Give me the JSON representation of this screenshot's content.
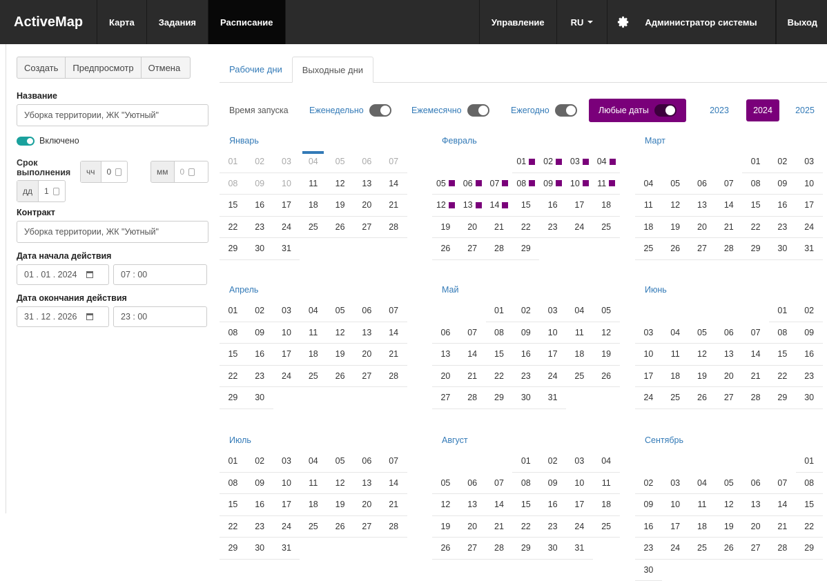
{
  "nav": {
    "brand": "ActiveMap",
    "items": [
      {
        "label": "Карта",
        "name": "nav-item-map"
      },
      {
        "label": "Задания",
        "name": "nav-item-tasks"
      },
      {
        "label": "Расписание",
        "name": "nav-item-schedule"
      }
    ],
    "right": {
      "manage": "Управление",
      "lang": "RU",
      "user": "Администратор системы",
      "logout": "Выход"
    }
  },
  "toolbar": {
    "create": "Создать",
    "preview": "Предпросмотр",
    "cancel": "Отмена"
  },
  "form": {
    "name_label": "Название",
    "name_value": "Уборка территории, ЖК \"Уютный\"",
    "enabled_label": "Включено",
    "deadline_label": "Срок выполнения",
    "hh_label": "чч",
    "hh_value": "0",
    "mm_label": "мм",
    "mm_value": "0",
    "dd_label": "дд",
    "dd_value": "1",
    "contract_label": "Контракт",
    "contract_value": "Уборка территории, ЖК \"Уютный\"",
    "start_label": "Дата начала действия",
    "start_date": "01 . 01 . 2024",
    "start_time": "07 : 00",
    "end_label": "Дата окончания действия",
    "end_date": "31 . 12 . 2026",
    "end_time": "23 : 00"
  },
  "tabs": {
    "workdays": "Рабочие дни",
    "weekends": "Выходные дни"
  },
  "options": {
    "launch_time": "Время запуска",
    "weekly": "Еженедельно",
    "monthly": "Ежемесячно",
    "yearly": "Ежегодно",
    "any_dates": "Любые даты",
    "years": [
      "2023",
      "2024",
      "2025"
    ],
    "selected_year": "2024"
  },
  "months": [
    {
      "name": "Январь",
      "offset": 0,
      "days": 31,
      "past_through": 10,
      "today": 4,
      "marked": []
    },
    {
      "name": "Февраль",
      "offset": 3,
      "days": 29,
      "past_through": 0,
      "today": 0,
      "marked": [
        1,
        2,
        3,
        4,
        5,
        6,
        7,
        8,
        9,
        10,
        11,
        12,
        13,
        14
      ]
    },
    {
      "name": "Март",
      "offset": 4,
      "days": 31,
      "past_through": 0,
      "today": 0,
      "marked": []
    },
    {
      "name": "Апрель",
      "offset": 0,
      "days": 30,
      "past_through": 0,
      "today": 0,
      "marked": []
    },
    {
      "name": "Май",
      "offset": 2,
      "days": 31,
      "past_through": 0,
      "today": 0,
      "marked": []
    },
    {
      "name": "Июнь",
      "offset": 5,
      "days": 30,
      "past_through": 0,
      "today": 0,
      "marked": []
    },
    {
      "name": "Июль",
      "offset": 0,
      "days": 31,
      "past_through": 0,
      "today": 0,
      "marked": []
    },
    {
      "name": "Август",
      "offset": 3,
      "days": 31,
      "past_through": 0,
      "today": 0,
      "marked": []
    },
    {
      "name": "Сентябрь",
      "offset": 6,
      "days": 30,
      "past_through": 0,
      "today": 0,
      "marked": []
    }
  ],
  "colors": {
    "accent": "#7a007a",
    "link": "#337ab7",
    "toggle_on": "#1aa19d",
    "nav_bg": "#2b2b2b"
  }
}
